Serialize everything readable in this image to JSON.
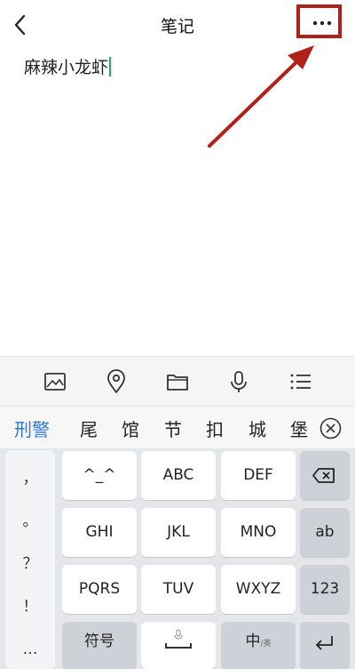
{
  "header": {
    "title": "笔记",
    "back_icon": "chevron-left-icon",
    "more_icon": "more-horizontal-icon",
    "highlight_color": "#b0211a"
  },
  "note": {
    "content": "麻辣小龙虾",
    "caret_color": "#1fa97a"
  },
  "toolbar": {
    "icons": [
      "image-icon",
      "location-icon",
      "folder-icon",
      "microphone-icon",
      "list-icon"
    ]
  },
  "candidates": {
    "items": [
      "刑警",
      "尾",
      "馆",
      "节",
      "扣",
      "城",
      "堡"
    ],
    "highlight_color": "#2f79d6",
    "close_icon": "close-circle-icon"
  },
  "keyboard": {
    "punctuation": [
      "，",
      "。",
      "？",
      "！",
      "…"
    ],
    "keys": {
      "r1c1": "^_^",
      "r1c2": "ABC",
      "r1c3": "DEF",
      "r2c1": "GHI",
      "r2c2": "JKL",
      "r2c3": "MNO",
      "r3c1": "PQRS",
      "r3c2": "TUV",
      "r3c3": "WXYZ"
    },
    "function_keys": {
      "backspace_icon": "backspace-icon",
      "ab": "ab",
      "num": "123",
      "enter_icon": "enter-icon"
    },
    "bottom": {
      "symbols": "符号",
      "lang_main": "中",
      "lang_sub": "/英",
      "mic_icon": "microphone-icon"
    }
  }
}
